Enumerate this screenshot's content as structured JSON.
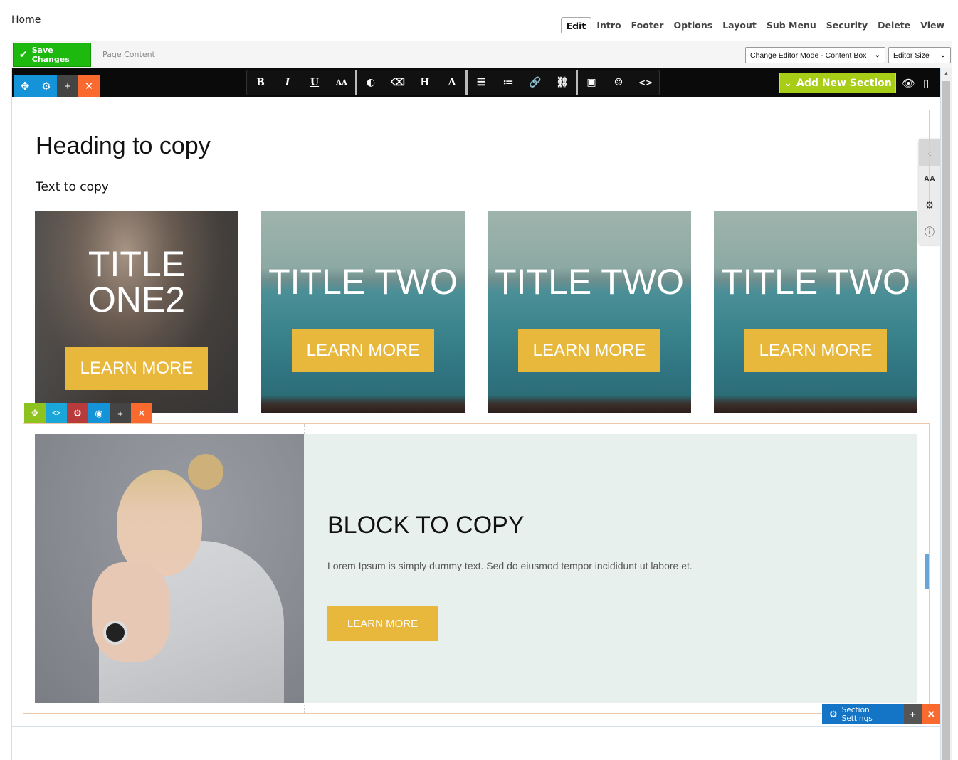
{
  "header": {
    "breadcrumb": "Home",
    "tabs": [
      "Edit",
      "Intro",
      "Footer",
      "Options",
      "Layout",
      "Sub Menu",
      "Security",
      "Delete",
      "View"
    ],
    "active_tab": "Edit"
  },
  "toolbar": {
    "save_label": "Save Changes",
    "page_content_label": "Page Content",
    "editor_mode_select": "Change Editor Mode - Content Box",
    "editor_size_select": "Editor Size"
  },
  "editor": {
    "add_section_label": "Add New Section",
    "format_buttons": [
      "bold-icon",
      "italic-icon",
      "underline-icon",
      "font-size-icon",
      "color-icon",
      "eraser-icon",
      "heading-icon",
      "text-color-icon",
      "align-icon",
      "list-icon",
      "link-icon",
      "unlink-icon",
      "image-icon",
      "emoji-icon",
      "code-icon"
    ],
    "side_tools": [
      "chevron-left-icon",
      "font-size-icon",
      "gear-icon",
      "info-icon"
    ]
  },
  "content": {
    "heading": "Heading to copy",
    "subtext": "Text to copy",
    "cards": [
      {
        "title": "TITLE ONE2",
        "button": "LEARN MORE"
      },
      {
        "title": "TITLE TWO",
        "button": "LEARN MORE"
      },
      {
        "title": "TITLE TWO",
        "button": "LEARN MORE"
      },
      {
        "title": "TITLE TWO",
        "button": "LEARN MORE"
      }
    ],
    "block": {
      "title": "BLOCK TO COPY",
      "text": "Lorem Ipsum is simply dummy text. Sed do eiusmod tempor incididunt ut labore et.",
      "button": "LEARN MORE"
    },
    "section_settings_label": "Section Settings"
  },
  "colors": {
    "save_green": "#1db90f",
    "add_section_lime": "#a8cd17",
    "button_gold": "#e8b83d",
    "control_blue": "#1593d8",
    "control_orange": "#fa6a2f"
  }
}
